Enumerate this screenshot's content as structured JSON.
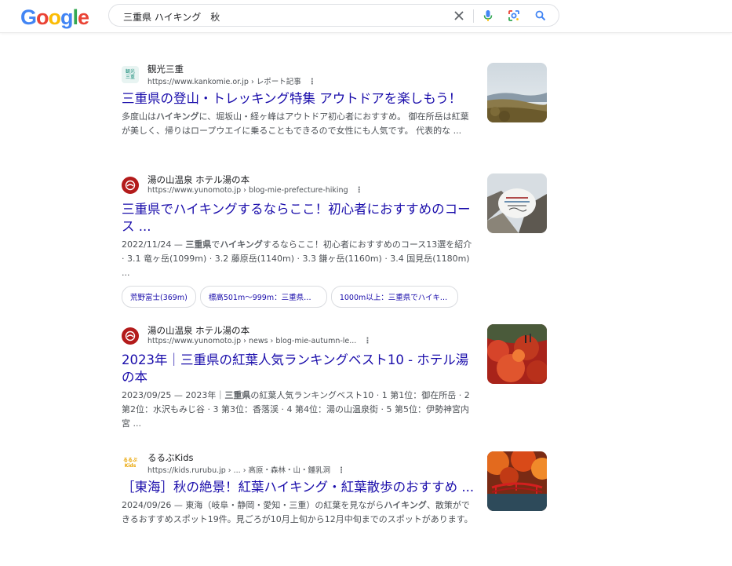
{
  "header": {
    "logo_letters": [
      {
        "ch": "G",
        "color": "#4285f4"
      },
      {
        "ch": "o",
        "color": "#ea4335"
      },
      {
        "ch": "o",
        "color": "#fbbc05"
      },
      {
        "ch": "g",
        "color": "#4285f4"
      },
      {
        "ch": "l",
        "color": "#34a853"
      },
      {
        "ch": "e",
        "color": "#ea4335"
      }
    ],
    "search_value": "三重県 ハイキング　秋",
    "icons": [
      "close-icon",
      "microphone-icon",
      "lens-icon",
      "search-icon"
    ]
  },
  "results": [
    {
      "site_name": "観光三重",
      "url": "https://www.kankomie.or.jp › レポート記事",
      "title": "三重県の登山・トレッキング特集 アウトドアを楽しもう！",
      "snippet": "多度山はハイキングに、堀坂山・経ヶ峰はアウトドア初心者におすすめ。 御在所岳は紅葉が美しく、帰りはロープウエイに乗ることもできるので女性にも人気です。 代表的な ...",
      "favicon_text": "観光三重",
      "thumb": "mountain-view"
    },
    {
      "site_name": "湯の山温泉 ホテル湯の本",
      "url": "https://www.yunomoto.jp › blog-mie-prefecture-hiking",
      "title": "三重県でハイキングするならここ！初心者におすすめのコース ...",
      "snippet": "2022/11/24 — 三重県でハイキングするならここ！初心者におすすめのコース13選を紹介 · 3.1 竜ヶ岳(1099m) · 3.2 藤原岳(1140m) · 3.3 鎌ヶ岳(1160m) · 3.4 国見岳(1180m) ...",
      "chips": [
        "荒野富士(369m)",
        "標高501m～999m：三重県でハ...",
        "1000m以上：三重県でハイキン..."
      ],
      "thumb": "rocky-hiking"
    },
    {
      "site_name": "湯の山温泉 ホテル湯の本",
      "url": "https://www.yunomoto.jp › news › blog-mie-autumn-le...",
      "title": "2023年｜三重県の紅葉人気ランキングベスト10 - ホテル湯の本",
      "snippet": "2023/09/25 — 2023年｜三重県の紅葉人気ランキングベスト10 · 1 第1位：御在所岳 · 2 第2位：水沢もみじ谷 · 3 第3位：香落渓 · 4 第4位：湯の山温泉街 · 5 第5位：伊勢神宮内宮 ...",
      "thumb": "red-foliage"
    },
    {
      "site_name": "るるぶKids",
      "url": "https://kids.rurubu.jp › ... › 高原・森林・山・鍾乳洞",
      "title": "［東海］秋の絶景！紅葉ハイキング・紅葉散歩のおすすめ ...",
      "snippet": "2024/09/26 — 東海（岐阜・静岡・愛知・三重）の紅葉を見ながらハイキング、散策ができるおすすめスポット19件。見ごろが10月上旬から12月中旬までのスポットがあります。",
      "favicon_text": "るるぶ Kids",
      "thumb": "red-bridge"
    }
  ],
  "colors": {
    "link": "#1a0dab",
    "snippet": "#4d5156",
    "accent_red": "#b31b1b"
  }
}
